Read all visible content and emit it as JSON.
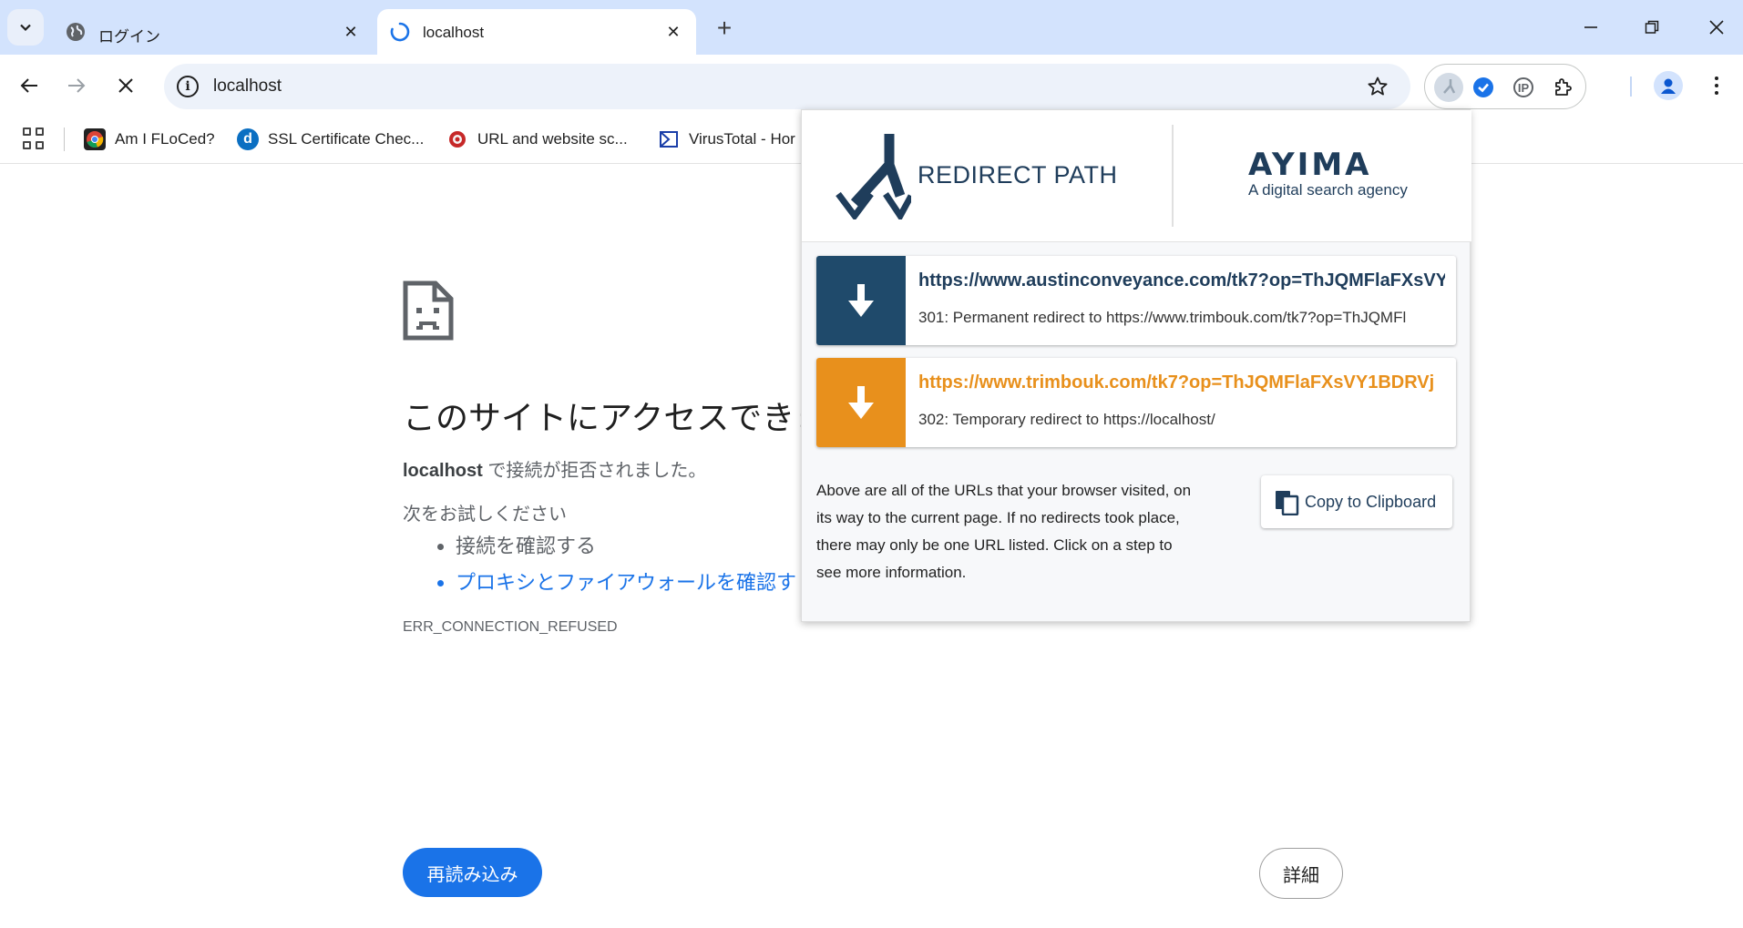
{
  "tabs": [
    {
      "title": "ログイン",
      "close": "✕"
    },
    {
      "title": "localhost",
      "close": "✕"
    }
  ],
  "new_tab": "+",
  "address": {
    "url": "localhost"
  },
  "bookmarks": [
    {
      "label": "Am I FLoCed?"
    },
    {
      "label": "SSL Certificate Chec..."
    },
    {
      "label": "URL and website sc..."
    },
    {
      "label": "VirusTotal - Hor"
    }
  ],
  "ext": {
    "ip_label": "IP"
  },
  "error_page": {
    "heading": "このサイトにアクセスできま",
    "host": "localhost",
    "refused": " で接続が拒否されました。",
    "try_label": "次をお試しください",
    "suggestions": [
      "接続を確認する",
      "プロキシとファイアウォールを確認す"
    ],
    "code": "ERR_CONNECTION_REFUSED",
    "reload_label": "再読み込み",
    "details_label": "詳細"
  },
  "popup": {
    "title": "REDIRECT PATH",
    "brand": "AYIMA",
    "brand_tagline": "A digital search agency",
    "steps": [
      {
        "url": "https://www.austinconveyance.com/tk7?op=ThJQMFlaFXsVY",
        "desc": "301: Permanent redirect to https://www.trimbouk.com/tk7?op=ThJQMFl",
        "color": "#1f4a6b"
      },
      {
        "url": "https://www.trimbouk.com/tk7?op=ThJQMFlaFXsVY1BDRVj",
        "desc": "302: Temporary redirect to https://localhost/",
        "color": "#e8901c"
      }
    ],
    "description": "Above are all of the URLs that your browser visited, on its way to the current page. If no redirects took place, there may only be one URL listed. Click on a step to see more information.",
    "copy_label": "Copy to Clipboard"
  }
}
